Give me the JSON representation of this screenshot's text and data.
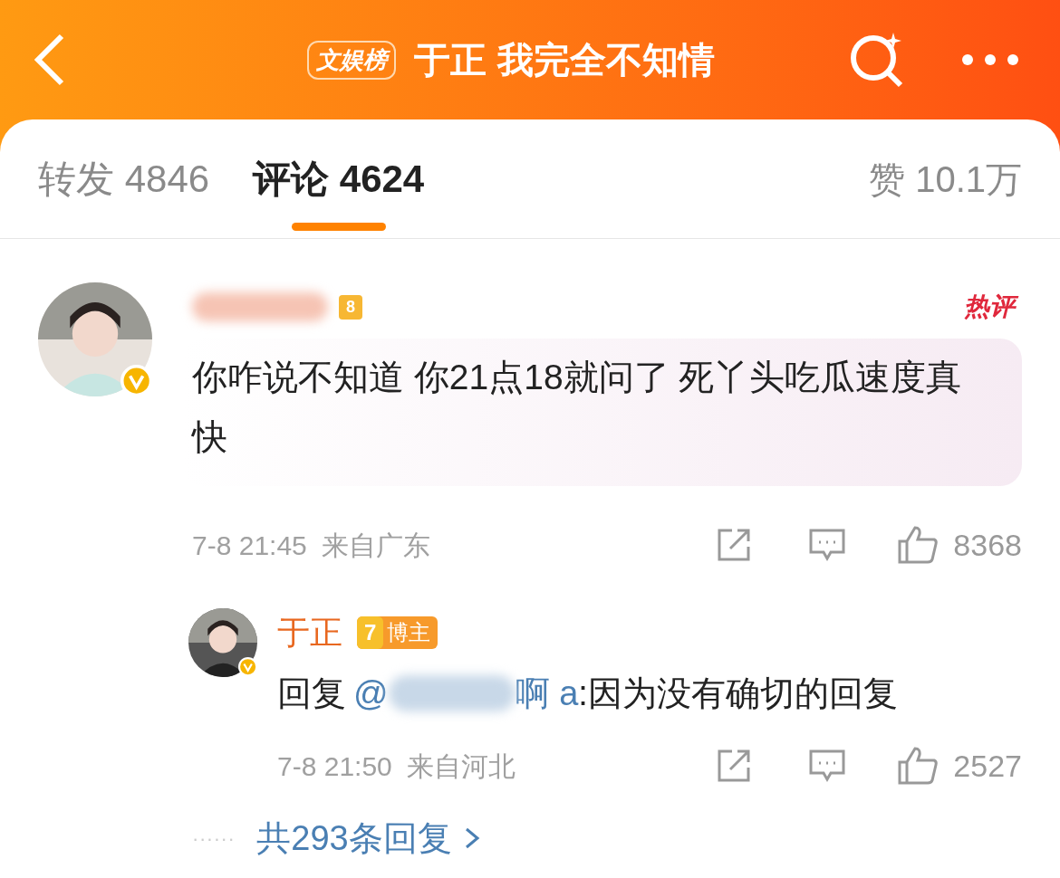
{
  "header": {
    "tag": "文娱榜",
    "title": "于正 我完全不知情"
  },
  "tabs": [
    {
      "label": "转发",
      "count": "4846",
      "selected": false
    },
    {
      "label": "评论",
      "count": "4624",
      "selected": true
    }
  ],
  "likes": {
    "label": "赞",
    "count": "10.1万"
  },
  "comments": [
    {
      "kind": "main",
      "level": "8",
      "hot_badge": "热评",
      "text": "你咋说不知道 你21点18就问了 死丫头吃瓜速度真快",
      "time": "7-8 21:45",
      "location": "来自广东",
      "like_count": "8368"
    },
    {
      "kind": "reply",
      "name": "于正",
      "crown_level": "7",
      "role": "博主",
      "prefix": "回复",
      "mention_start": "@",
      "mention_end": "啊 a",
      "text": ":因为没有确切的回复",
      "time": "7-8 21:50",
      "location": "来自河北",
      "like_count": "2527"
    }
  ],
  "more_replies": {
    "dots": "······",
    "text": "共293条回复"
  }
}
